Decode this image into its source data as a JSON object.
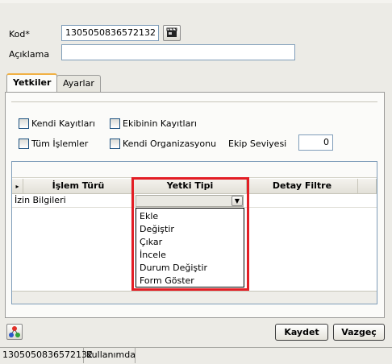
{
  "form": {
    "kod_label": "Kod*",
    "kod_value": "1305050836572132",
    "aciklama_label": "Açıklama",
    "aciklama_value": ""
  },
  "tabs": [
    {
      "label": "Yetkiler",
      "active": true
    },
    {
      "label": "Ayarlar",
      "active": false
    }
  ],
  "checkboxes": {
    "kendi_kayitlari": "Kendi Kayıtları",
    "ekibinin_kayitlari": "Ekibinin Kayıtları",
    "tum_islemler": "Tüm İşlemler",
    "kendi_organizasyonu": "Kendi Organizasyonu"
  },
  "ekip_seviyesi": {
    "label": "Ekip Seviyesi",
    "value": "0"
  },
  "grid": {
    "columns": [
      "İşlem Türü",
      "Yetki Tipi",
      "Detay Filtre"
    ],
    "row_indicator": "▸",
    "rows": [
      {
        "islem_turu": "İzin Bilgileri",
        "yetki_tipi": "",
        "detay_filtre": ""
      }
    ],
    "dropdown_options": [
      "Ekle",
      "Değiştir",
      "Çıkar",
      "İncele",
      "Durum Değiştir",
      "Form Göster"
    ]
  },
  "buttons": {
    "save": "Kaydet",
    "cancel": "Vazgeç"
  },
  "status_bar": {
    "code": "1305050836572132",
    "state": "Kullanımda"
  },
  "colors": {
    "highlight_border": "#e31e25",
    "tab_accent": "#f1b043",
    "field_border": "#7f9db9"
  }
}
